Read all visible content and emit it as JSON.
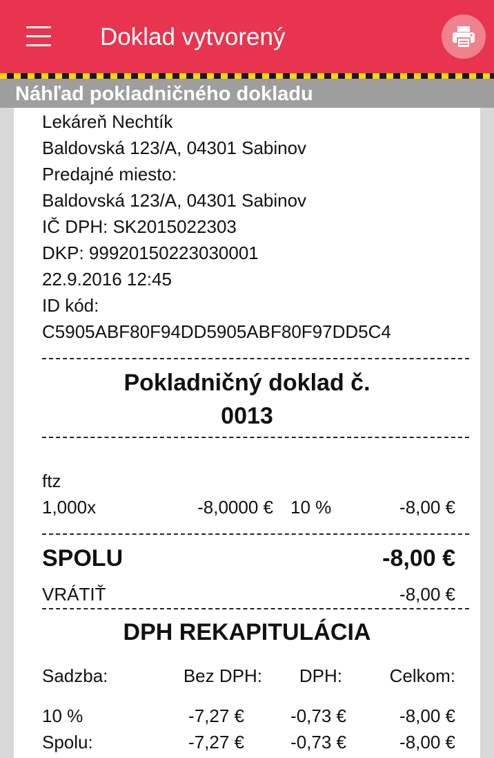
{
  "appbar": {
    "title": "Doklad vytvorený",
    "menu_icon": "hamburger-menu-icon",
    "print_icon": "printer-icon",
    "colors": {
      "bar": "#e8344f",
      "print_button": "#f0818f",
      "stripe_a": "#ffd600",
      "stripe_b": "#1a1a1a"
    }
  },
  "section_header": "Náhľad pokladničného dokladu",
  "store": {
    "name": "Lekáreň Nechtík",
    "address": "Baldovská 123/A, 04301 Sabinov",
    "sale_point_label": "Predajné miesto:",
    "sale_point_address": "Baldovská 123/A, 04301 Sabinov",
    "vat_id_label": "IČ DPH:",
    "vat_id": "SK2015022303",
    "dkp_label": "DKP:",
    "dkp": "99920150223030001",
    "datetime": "22.9.2016 12:45",
    "id_code_label": "ID kód:",
    "id_code": "C5905ABF80F94DD5905ABF80F97DD5C4"
  },
  "receipt_title": {
    "line1": "Pokladničný doklad č.",
    "line2": "0013"
  },
  "items": [
    {
      "name": "ftz",
      "qty": "1,000x",
      "unit_price": "-8,0000 €",
      "vat": "10 %",
      "total": "-8,00 €"
    }
  ],
  "totals": {
    "sum_label": "SPOLU",
    "sum_value": "-8,00 €",
    "return_label": "VRÁTIŤ",
    "return_value": "-8,00 €"
  },
  "vat_recap": {
    "title": "DPH REKAPITULÁCIA",
    "headers": [
      "Sadzba:",
      "Bez DPH:",
      "DPH:",
      "Celkom:"
    ],
    "rows": [
      [
        "10 %",
        "-7,27 €",
        "-0,73 €",
        "-8,00 €"
      ],
      [
        "Spolu:",
        "-7,27 €",
        "-0,73 €",
        "-8,00 €"
      ]
    ]
  }
}
